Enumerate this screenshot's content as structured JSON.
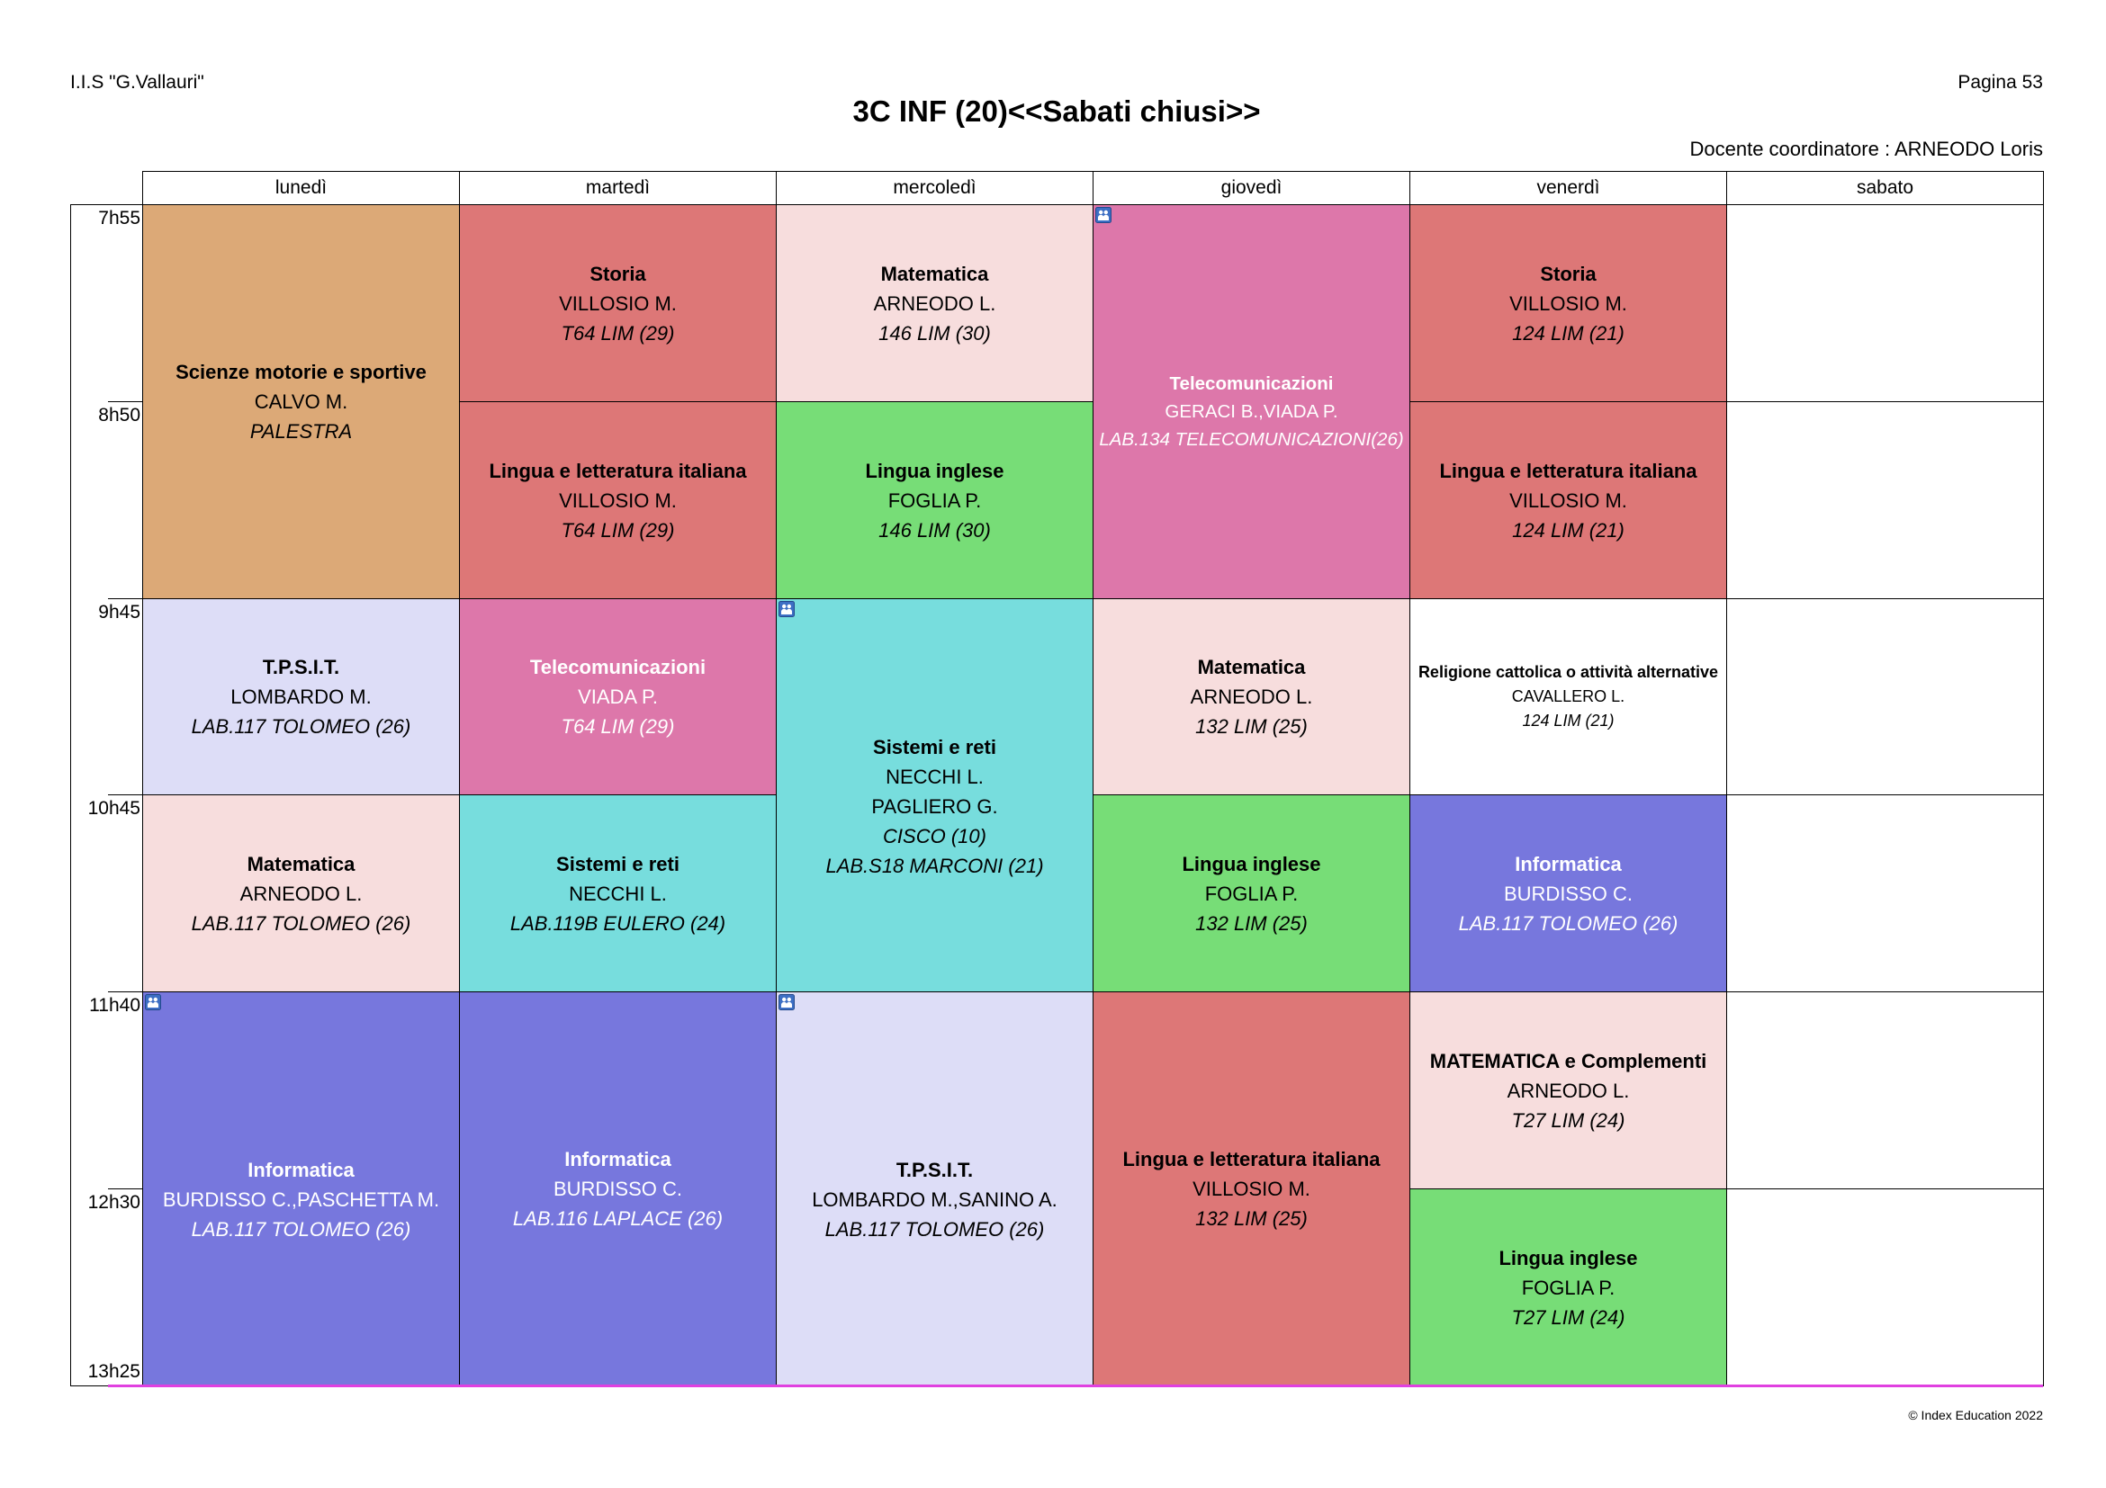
{
  "header": {
    "school": "I.I.S \"G.Vallauri\"",
    "page": "Pagina 53",
    "title": "3C INF (20)<<Sabati chiusi>>",
    "coordinator": "Docente coordinatore : ARNEODO Loris"
  },
  "days": [
    "lunedì",
    "martedì",
    "mercoledì",
    "giovedì",
    "venerdì",
    "sabato"
  ],
  "times": [
    "7h55",
    "8h50",
    "9h45",
    "10h45",
    "11h40",
    "12h30",
    "13h25"
  ],
  "colors": {
    "grid_lines": "#000000",
    "end_of_day_line": "#E040E0"
  },
  "lessons": [
    {
      "day": "lunedì",
      "start": "7h55",
      "end": "9h45",
      "subject": "Scienze motorie e sportive",
      "teachers": [
        "CALVO M."
      ],
      "rooms": [
        "PALESTRA"
      ],
      "color": "#DCA977",
      "text_color": "#000000"
    },
    {
      "day": "lunedì",
      "start": "9h45",
      "end": "10h45",
      "subject": "T.P.S.I.T.",
      "teachers": [
        "LOMBARDO M."
      ],
      "rooms": [
        "LAB.117 TOLOMEO (26)"
      ],
      "color": "#DDDDF7",
      "text_color": "#000000"
    },
    {
      "day": "lunedì",
      "start": "10h45",
      "end": "11h40",
      "subject": "Matematica",
      "teachers": [
        "ARNEODO L."
      ],
      "rooms": [
        "LAB.117 TOLOMEO (26)"
      ],
      "color": "#F7DDDD",
      "text_color": "#000000"
    },
    {
      "day": "lunedì",
      "start": "11h40",
      "end": "13h25",
      "subject": "Informatica",
      "teachers": [
        "BURDISSO C.,PASCHETTA M."
      ],
      "rooms": [
        "LAB.117 TOLOMEO (26)"
      ],
      "color": "#7777DD",
      "text_color": "#FFFFFF",
      "icon": "group-icon"
    },
    {
      "day": "martedì",
      "start": "7h55",
      "end": "8h50",
      "subject": "Storia",
      "teachers": [
        "VILLOSIO M."
      ],
      "rooms": [
        "T64 LIM (29)"
      ],
      "color": "#DD7777",
      "text_color": "#000000"
    },
    {
      "day": "martedì",
      "start": "8h50",
      "end": "9h45",
      "subject": "Lingua e letteratura italiana",
      "teachers": [
        "VILLOSIO M."
      ],
      "rooms": [
        "T64 LIM (29)"
      ],
      "color": "#DD7777",
      "text_color": "#000000"
    },
    {
      "day": "martedì",
      "start": "9h45",
      "end": "10h45",
      "subject": "Telecomunicazioni",
      "teachers": [
        "VIADA P."
      ],
      "rooms": [
        "T64 LIM (29)"
      ],
      "color": "#DD77AA",
      "text_color": "#FFFFFF"
    },
    {
      "day": "martedì",
      "start": "10h45",
      "end": "11h40",
      "subject": "Sistemi e reti",
      "teachers": [
        "NECCHI L."
      ],
      "rooms": [
        "LAB.119B EULERO (24)"
      ],
      "color": "#77DDDD",
      "text_color": "#000000"
    },
    {
      "day": "martedì",
      "start": "11h40",
      "end": "13h25",
      "subject": "Informatica",
      "teachers": [
        "BURDISSO C."
      ],
      "rooms": [
        "LAB.116 LAPLACE (26)"
      ],
      "color": "#7777DD",
      "text_color": "#FFFFFF"
    },
    {
      "day": "mercoledì",
      "start": "7h55",
      "end": "8h50",
      "subject": "Matematica",
      "teachers": [
        "ARNEODO L."
      ],
      "rooms": [
        "146 LIM (30)"
      ],
      "color": "#F7DDDD",
      "text_color": "#000000"
    },
    {
      "day": "mercoledì",
      "start": "8h50",
      "end": "9h45",
      "subject": "Lingua inglese",
      "teachers": [
        "FOGLIA P."
      ],
      "rooms": [
        "146 LIM (30)"
      ],
      "color": "#77DD77",
      "text_color": "#000000"
    },
    {
      "day": "mercoledì",
      "start": "9h45",
      "end": "11h40",
      "subject": "Sistemi e reti",
      "teachers": [
        "NECCHI L.",
        "PAGLIERO G."
      ],
      "rooms": [
        "CISCO (10)",
        "LAB.S18 MARCONI (21)"
      ],
      "color": "#77DDDD",
      "text_color": "#000000",
      "icon": "group-icon"
    },
    {
      "day": "mercoledì",
      "start": "11h40",
      "end": "13h25",
      "subject": "T.P.S.I.T.",
      "teachers": [
        "LOMBARDO M.,SANINO A."
      ],
      "rooms": [
        "LAB.117 TOLOMEO (26)"
      ],
      "color": "#DDDDF7",
      "text_color": "#000000",
      "icon": "group-icon"
    },
    {
      "day": "giovedì",
      "start": "7h55",
      "end": "9h45",
      "subject": "Telecomunicazioni",
      "teachers": [
        "GERACI B.,VIADA P."
      ],
      "rooms": [
        "LAB.134 TELECOMUNICAZIONI(26)"
      ],
      "color": "#DD77AA",
      "text_color": "#FFFFFF",
      "icon": "group-icon"
    },
    {
      "day": "giovedì",
      "start": "9h45",
      "end": "10h45",
      "subject": "Matematica",
      "teachers": [
        "ARNEODO L."
      ],
      "rooms": [
        "132 LIM (25)"
      ],
      "color": "#F7DDDD",
      "text_color": "#000000"
    },
    {
      "day": "giovedì",
      "start": "10h45",
      "end": "11h40",
      "subject": "Lingua inglese",
      "teachers": [
        "FOGLIA P."
      ],
      "rooms": [
        "132 LIM (25)"
      ],
      "color": "#77DD77",
      "text_color": "#000000"
    },
    {
      "day": "giovedì",
      "start": "11h40",
      "end": "13h25",
      "subject": "Lingua e letteratura italiana",
      "teachers": [
        "VILLOSIO M."
      ],
      "rooms": [
        "132 LIM (25)"
      ],
      "color": "#DD7777",
      "text_color": "#000000"
    },
    {
      "day": "venerdì",
      "start": "7h55",
      "end": "8h50",
      "subject": "Storia",
      "teachers": [
        "VILLOSIO M."
      ],
      "rooms": [
        "124 LIM (21)"
      ],
      "color": "#DD7777",
      "text_color": "#000000"
    },
    {
      "day": "venerdì",
      "start": "8h50",
      "end": "9h45",
      "subject": "Lingua e letteratura italiana",
      "teachers": [
        "VILLOSIO M."
      ],
      "rooms": [
        "124 LIM (21)"
      ],
      "color": "#DD7777",
      "text_color": "#000000"
    },
    {
      "day": "venerdì",
      "start": "9h45",
      "end": "10h45",
      "subject": "Religione cattolica o attività alternative",
      "teachers": [
        "CAVALLERO L."
      ],
      "rooms": [
        "124 LIM (21)"
      ],
      "color": "#FFFFFF",
      "text_color": "#000000"
    },
    {
      "day": "venerdì",
      "start": "10h45",
      "end": "11h40",
      "subject": "Informatica",
      "teachers": [
        "BURDISSO C."
      ],
      "rooms": [
        "LAB.117 TOLOMEO (26)"
      ],
      "color": "#7777DD",
      "text_color": "#FFFFFF"
    },
    {
      "day": "venerdì",
      "start": "11h40",
      "end": "12h30",
      "subject": "MATEMATICA e Complementi",
      "teachers": [
        "ARNEODO L."
      ],
      "rooms": [
        "T27 LIM (24)"
      ],
      "color": "#F7DDDD",
      "text_color": "#000000"
    },
    {
      "day": "venerdì",
      "start": "12h30",
      "end": "13h25",
      "subject": "Lingua inglese",
      "teachers": [
        "FOGLIA P."
      ],
      "rooms": [
        "T27 LIM (24)"
      ],
      "color": "#77DD77",
      "text_color": "#000000"
    }
  ],
  "footer": {
    "copyright": "© Index Education 2022"
  }
}
